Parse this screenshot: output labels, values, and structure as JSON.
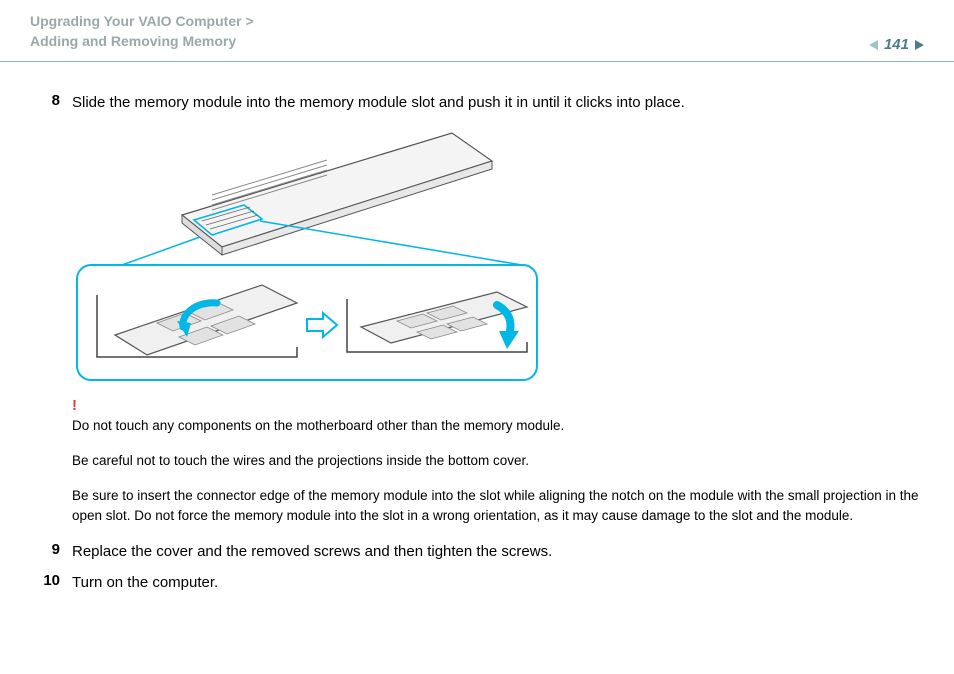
{
  "header": {
    "breadcrumb_line1": "Upgrading Your VAIO Computer >",
    "breadcrumb_line2": "Adding and Removing Memory",
    "page_number": "141"
  },
  "steps": {
    "s8": {
      "num": "8",
      "text": "Slide the memory module into the memory module slot and push it in until it clicks into place."
    },
    "s9": {
      "num": "9",
      "text": "Replace the cover and the removed screws and then tighten the screws."
    },
    "s10": {
      "num": "10",
      "text": "Turn on the computer."
    }
  },
  "warnings": {
    "mark": "!",
    "w1": "Do not touch any components on the motherboard other than the memory module.",
    "w2": "Be careful not to touch the wires and the projections inside the bottom cover.",
    "w3": "Be sure to insert the connector edge of the memory module into the slot while aligning the notch on the module with the small projection in the open slot. Do not force the memory module into the slot in a wrong orientation, as it may cause damage to the slot and the module."
  }
}
